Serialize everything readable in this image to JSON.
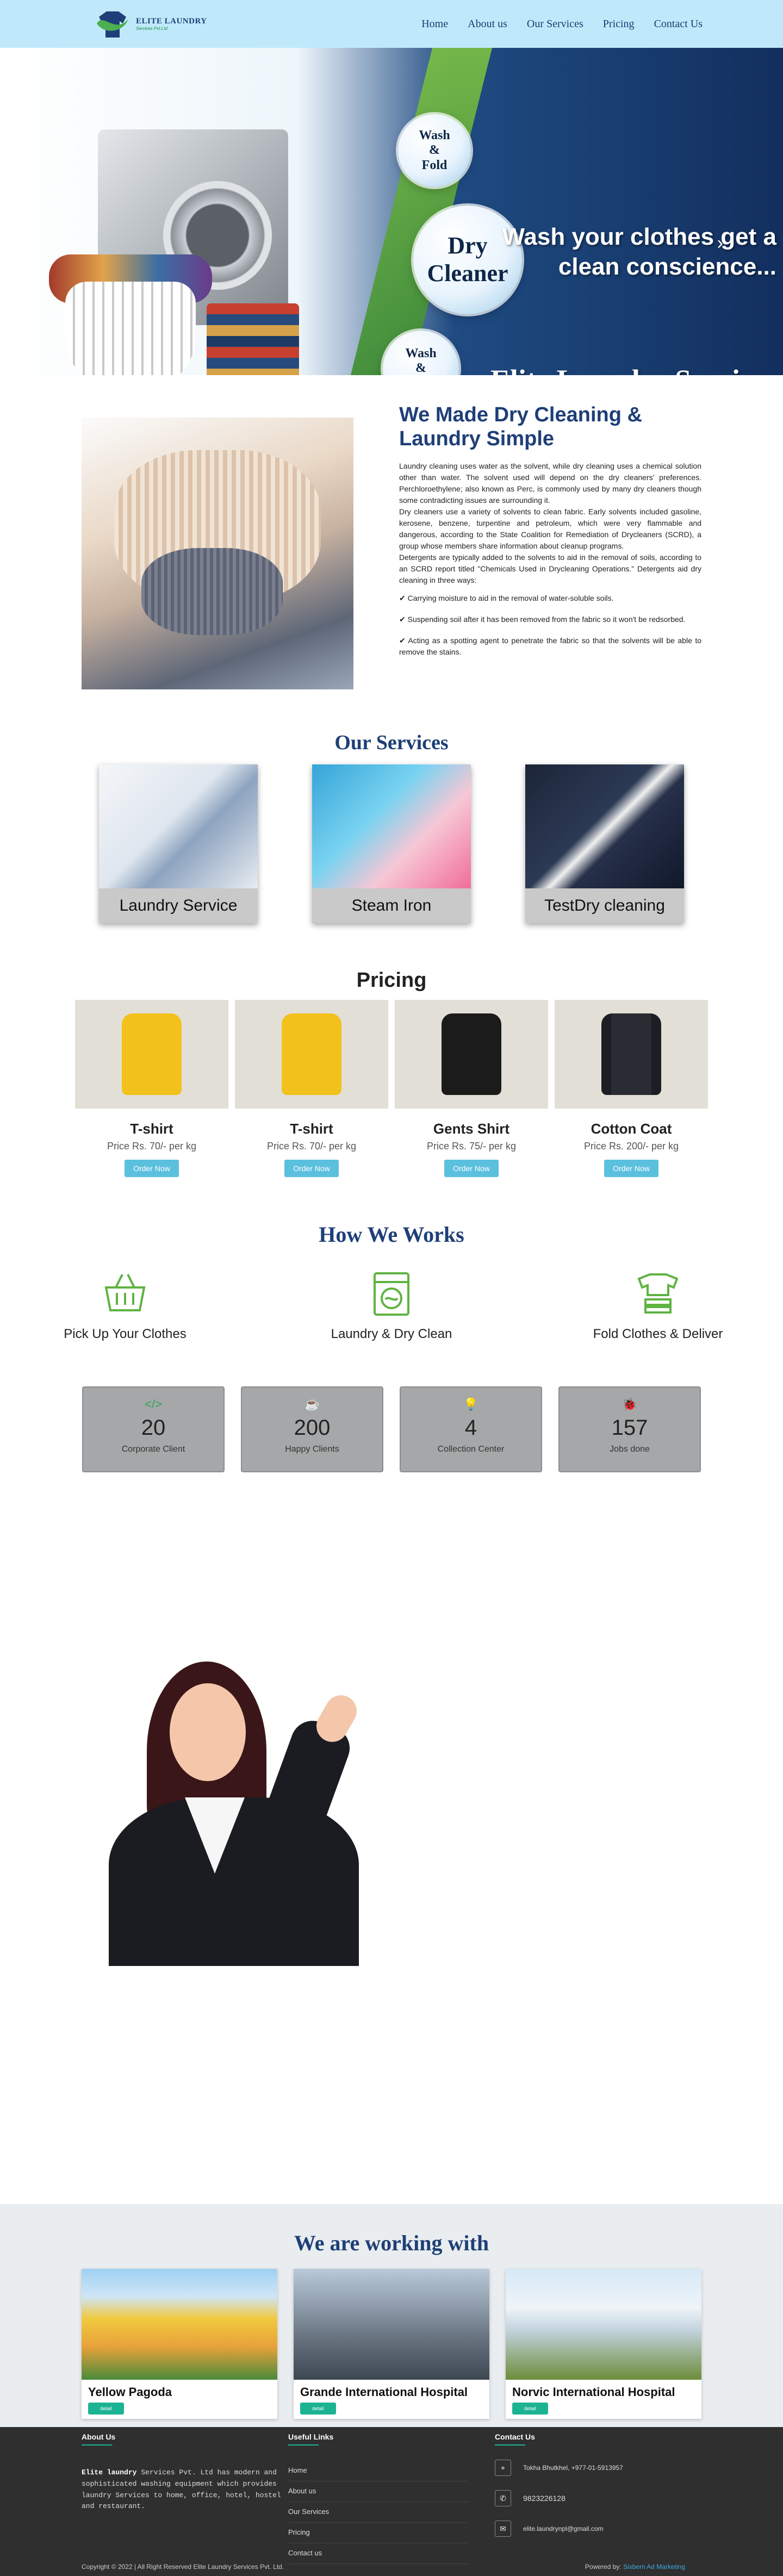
{
  "nav": {
    "logo_name": "ELITE LAUNDRY",
    "logo_sub": "Services Pvt.Ltd",
    "links": [
      "Home",
      "About us",
      "Our Services",
      "Pricing",
      "Contact Us"
    ]
  },
  "hero": {
    "bubble1": "Wash\n&\nFold",
    "bubble2": "Dry\nCleaner",
    "bubble3": "Wash\n&\nIron",
    "tagline": "Wash your clothes get a\nclean conscience...",
    "brand": "Elite Laundry Services"
  },
  "about": {
    "title": "We Made Dry Cleaning & Laundry Simple",
    "p1": "Laundry cleaning uses water as the solvent, while dry cleaning uses a chemical solution other than water. The solvent used will depend on the dry cleaners' preferences. Perchloroethylene; also known as Perc, is commonly used by many dry cleaners though some contradicting issues are surrounding it.",
    "p2": "Dry cleaners use a variety of solvents to clean fabric. Early solvents included gasoline, kerosene, benzene, turpentine and petroleum, which were very flammable and dangerous, according to the State Coalition for Remediation of Drycleaners (SCRD), a group whose members share information about cleanup programs.",
    "p3": "Detergents are typically added to the solvents to aid in the removal of soils, according to an SCRD report titled \"Chemicals Used in Drycleaning Operations.\" Detergents aid dry cleaning in three ways:",
    "points": [
      "✔ Carrying moisture to aid in the removal of water-soluble soils.",
      "✔ Suspending soil after it has been removed from the fabric so it won't be redsorbed.",
      "✔ Acting as a spotting agent to penetrate the fabric so that the solvents will be able to remove the stains."
    ]
  },
  "services": {
    "title": "Our Services",
    "items": [
      "Laundry Service",
      "Steam Iron",
      "TestDry cleaning"
    ]
  },
  "pricing": {
    "title": "Pricing",
    "button": "Order Now",
    "items": [
      {
        "name": "T-shirt",
        "price": "Price Rs. 70/- per kg"
      },
      {
        "name": "T-shirt",
        "price": "Price Rs. 70/- per kg"
      },
      {
        "name": "Gents Shirt",
        "price": "Price Rs. 75/- per kg"
      },
      {
        "name": "Cotton Coat",
        "price": "Price Rs. 200/- per kg"
      }
    ]
  },
  "how": {
    "title": "How We Works",
    "items": [
      "Pick Up Your Clothes",
      "Laundry & Dry Clean",
      "Fold Clothes & Deliver"
    ]
  },
  "stats": [
    {
      "num": "20",
      "label": "Corporate Client",
      "icon": "code-icon"
    },
    {
      "num": "200",
      "label": "Happy Clients",
      "icon": "coffee-icon"
    },
    {
      "num": "4",
      "label": "Collection Center",
      "icon": "lightbulb-icon"
    },
    {
      "num": "157",
      "label": "Jobs done",
      "icon": "bug-icon"
    }
  ],
  "partners": {
    "title": "We are working with",
    "button": "detail",
    "items": [
      "Yellow Pagoda",
      "Grande International Hospital",
      "Norvic International Hospital"
    ]
  },
  "footer": {
    "about_head": "About Us",
    "about_brand": "Elite laundry",
    "about_text": " Services Pvt. Ltd has modern and sophisticated washing equipment which provides laundry Services to home, office, hotel, hostel and restaurant.",
    "links_head": "Useful Links",
    "links": [
      "Home",
      "About us",
      "Our Services",
      "Pricing",
      "Contact us"
    ],
    "contact_head": "Contact Us",
    "address": "Tokha Bhutkhel, +977-01-5913957",
    "phone": "9823226128",
    "email": "elite.laundrynpl@gmail.com",
    "copyright": "Copyright © 2022 | All Right Reserved Elite Laundry Services Pvt. Ltd.",
    "powered_prefix": "Powered by:",
    "powered_link": "Sixbern Ad Marketing"
  },
  "colors": {
    "nav_bg": "#bfe9fb",
    "primary": "#1e3f77",
    "accent_green": "#1cb394",
    "order_btn": "#5bc0de"
  }
}
